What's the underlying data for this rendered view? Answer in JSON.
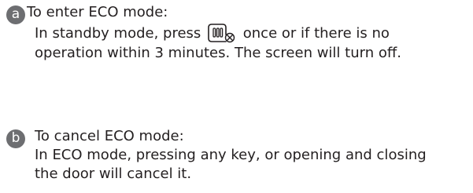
{
  "steps": [
    {
      "badge": "a",
      "title": "To enter ECO mode:",
      "body_before_icon": "In standby mode, press",
      "icon": "eco-key-icon",
      "body_after_icon": "once or if there is no",
      "body_line_2": "operation within 3 minutes. The screen will turn off."
    },
    {
      "badge": "b",
      "title": "To cancel ECO mode:",
      "body_line_1": "In ECO mode, pressing any key, or opening and closing",
      "body_line_2": "the door will cancel it."
    }
  ],
  "colors": {
    "badge": "#6d6e71",
    "text": "#231f20"
  }
}
